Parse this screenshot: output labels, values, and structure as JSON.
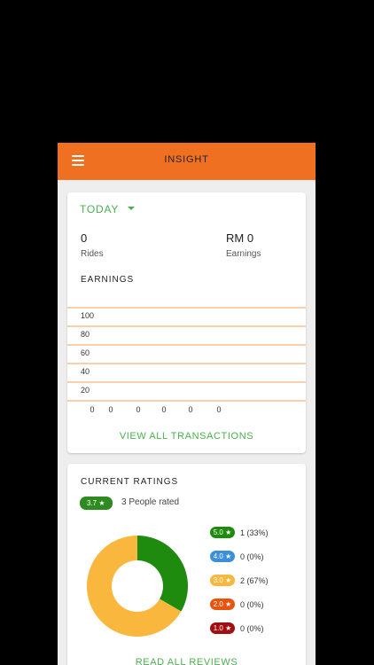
{
  "appbar": {
    "title": "INSIGHT"
  },
  "summary": {
    "period": "TODAY",
    "rides_value": "0",
    "rides_label": "Rides",
    "earnings_value": "RM 0",
    "earnings_label": "Earnings",
    "earnings_title": "EARNINGS",
    "view_all": "VIEW ALL TRANSACTIONS"
  },
  "chart_data": {
    "type": "bar",
    "title": "",
    "yticks": [
      "100",
      "80",
      "60",
      "40",
      "20"
    ],
    "ylim": [
      0,
      100
    ],
    "values": [
      0,
      0,
      0,
      0,
      0,
      0
    ],
    "value_labels": [
      "0",
      "0",
      "0",
      "0",
      "0",
      "0"
    ],
    "grid_color": "#f0a35a"
  },
  "ratings": {
    "title": "CURRENT RATINGS",
    "average": "3.7",
    "people": "3 People rated",
    "read_all": "READ ALL REVIEWS",
    "breakdown": [
      {
        "label": "5.0",
        "text": "1 (33%)",
        "color": "#1e8b0e",
        "count": 1
      },
      {
        "label": "4.0",
        "text": "0 (0%)",
        "color": "#3d8fd8",
        "count": 0
      },
      {
        "label": "3.0",
        "text": "2 (67%)",
        "color": "#f9b73d",
        "count": 2
      },
      {
        "label": "2.0",
        "text": "0 (0%)",
        "color": "#e8540c",
        "count": 0
      },
      {
        "label": "1.0",
        "text": "0 (0%)",
        "color": "#a11010",
        "count": 0
      }
    ]
  }
}
